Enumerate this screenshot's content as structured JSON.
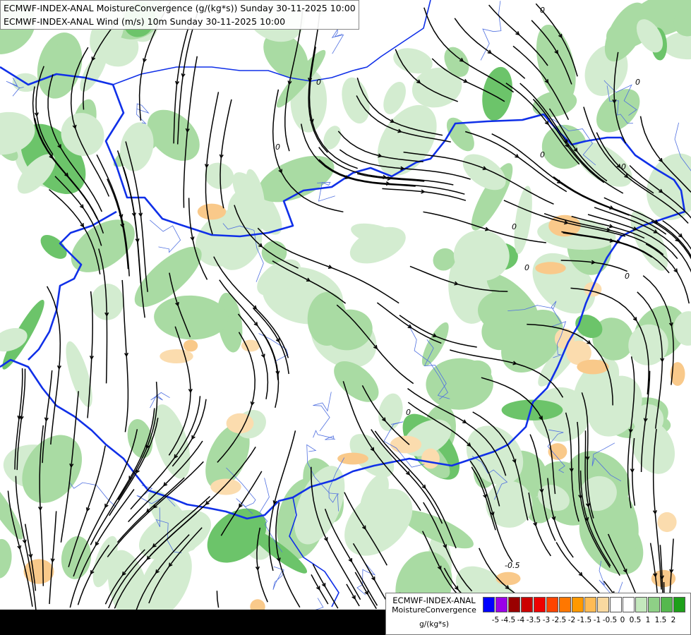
{
  "map": {
    "title_line1": "ECMWF-INDEX-ANAL MoistureConvergence (g/(kg*s)) Sunday 30-11-2025 10:00",
    "title_line2": "ECMWF-INDEX-ANAL Wind (m/s) 10m Sunday 30-11-2025 10:00",
    "field_labels": [
      "0",
      "0",
      "0",
      "0",
      "0",
      "0",
      "0",
      "0",
      "0",
      "0",
      "-0.5"
    ],
    "colors": {
      "low_convergence": "#d3ecd0",
      "mid_convergence": "#a9dba3",
      "high_convergence": "#6cc46a",
      "divergence_light": "#fbdcae",
      "divergence_mid": "#f9c98a",
      "border": "#1030e8",
      "river": "#5070e0",
      "streamline": "#000000"
    }
  },
  "legend": {
    "title_line1": "ECMWF-INDEX-ANAL",
    "title_line2": "MoistureConvergence",
    "unit": "g/(kg*s)",
    "swatches": [
      "#0000ff",
      "#9a00e8",
      "#9a0000",
      "#cc0000",
      "#ee0000",
      "#ff4400",
      "#ff7700",
      "#ff9900",
      "#ffbb55",
      "#f9d9a0",
      "#ffffff",
      "#ffffff",
      "#c4e8bd",
      "#8ed086",
      "#55b84e",
      "#1ea01a"
    ],
    "tick_labels": [
      "-5",
      "-4.5",
      "-4",
      "-3.5",
      "-3",
      "-2.5",
      "-2",
      "-1.5",
      "-1",
      "-0.5",
      "0",
      "0.5",
      "1",
      "1.5",
      "2"
    ]
  }
}
